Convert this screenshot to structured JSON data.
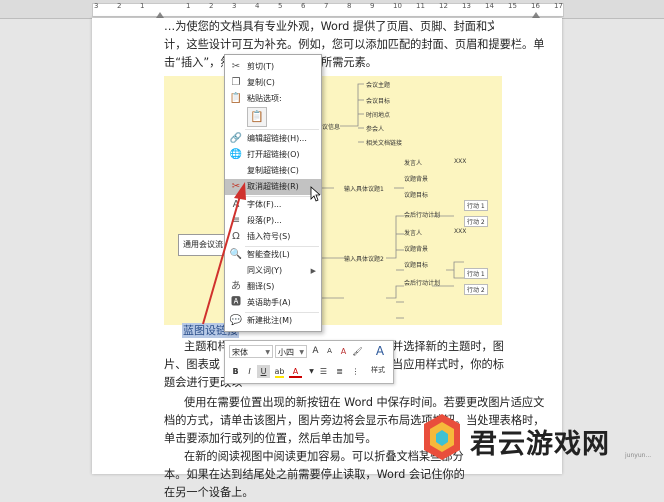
{
  "ruler": {
    "numbers": [
      "3",
      "2",
      "1",
      "",
      "1",
      "2",
      "3",
      "4",
      "5",
      "6",
      "7",
      "8",
      "9",
      "10",
      "11",
      "12",
      "13",
      "14",
      "15",
      "16",
      "17"
    ]
  },
  "document": {
    "para1_line0": "…为使您的文档具有专业外观，Word 提供了页眉、页脚、封面和文本框设",
    "para1_line1": "计，这些设计可互为补充。例如，您可以添加匹配的封面、页眉和提要栏。单",
    "para1_line2": "击“插入”，然后从不同库中选择所需元素。",
    "selected_link": "蓝图设链接",
    "para2_line0": "主题和样式……并选择新的主题时，图",
    "para2_line1": "片、图表或 Sm……当应用样式时，你的标",
    "para2_line2": "题会进行更改以…",
    "para2_line0_a": "主题和样式",
    "para2_line0_b": "并选择新的主题时，图",
    "para2_line1_a": "片、图表或 Sm",
    "para2_line1_b": "当应用样式时，你的标",
    "para2_line2_a": "题会进行更改以",
    "para3_line0": "使用在需要位置出现的新按钮在 Word 中保存时间。若要更改图片适应文",
    "para3_line1": "档的方式，请单击该图片，图片旁边将会显示布局选项按钮。当处理表格时，",
    "para3_line2": "单击要添加行或列的位置，然后单击加号。",
    "para4_line0": "在新的阅读视图中阅读更加容易。可以折叠文档某些部分",
    "para4_line1": "本。如果在达到结尾处之前需要停止读取，Word 会记住你的",
    "para4_line2": "在另一个设备上。"
  },
  "diagram": {
    "root": "通用会议流",
    "branch_meeting_info": "会议信息",
    "meeting_info_children": [
      "会议主题",
      "会议目标",
      "时间地点",
      "参会人",
      "相关文档链接"
    ],
    "topic1": "输入具体议题1",
    "topic2": "输入具体议题2",
    "speaker": "发言人",
    "xxx": "XXX",
    "background": "议题背景",
    "goal": "议题目标",
    "action_plan": "会后行动计划",
    "action1": "行动 1",
    "action2": "行动 2"
  },
  "context_menu": {
    "items": [
      {
        "label": "剪切(T)",
        "icon": "scissors-icon"
      },
      {
        "label": "复制(C)",
        "icon": "copy-icon"
      },
      {
        "label": "粘贴选项:",
        "icon": "paste-icon"
      },
      {
        "label": "编辑超链接(H)...",
        "icon": "edit-link-icon"
      },
      {
        "label": "打开超链接(O)",
        "icon": "open-link-icon"
      },
      {
        "label": "复制超链接(C)",
        "icon": ""
      },
      {
        "label": "取消超链接(R)",
        "icon": "remove-link-icon"
      },
      {
        "label": "字体(F)...",
        "icon": "font-icon"
      },
      {
        "label": "段落(P)...",
        "icon": "paragraph-icon"
      },
      {
        "label": "插入符号(S)",
        "icon": "symbol-icon"
      },
      {
        "label": "智能查找(L)",
        "icon": "smart-lookup-icon"
      },
      {
        "label": "同义词(Y)",
        "icon": ""
      },
      {
        "label": "翻译(S)",
        "icon": "translate-icon"
      },
      {
        "label": "英语助手(A)",
        "icon": "english-assistant-icon"
      },
      {
        "label": "新建批注(M)",
        "icon": "new-comment-icon"
      }
    ]
  },
  "mini_toolbar": {
    "font": "宋体",
    "size": "小四",
    "grow": "A",
    "shrink": "A",
    "clear": "A",
    "bold": "B",
    "italic": "I",
    "underline": "U",
    "font_color": "A",
    "styles_label": "样式"
  },
  "watermark": {
    "text": "君云游戏网",
    "sub": "junyun..."
  },
  "colors": {
    "diagram_bg": "#fcf5c0",
    "highlight": "#c2c2c2",
    "selection": "#b7c9e6",
    "red_arrow": "#d0312d"
  }
}
